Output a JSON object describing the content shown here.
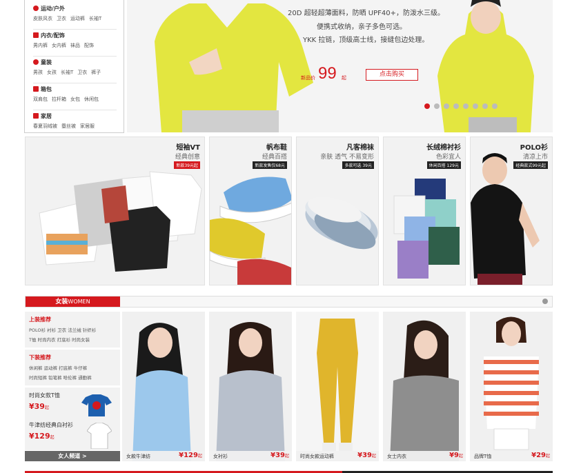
{
  "categories": [
    {
      "title": "运动/户外",
      "links": [
        "皮肤风衣",
        "卫衣",
        "运动裤",
        "长袖T"
      ]
    },
    {
      "title": "内衣/配饰",
      "links": [
        "男内裤",
        "女内裤",
        "袜品",
        "配饰"
      ]
    },
    {
      "title": "童装",
      "links": [
        "男孩",
        "女孩",
        "长袖T",
        "卫衣",
        "裤子"
      ]
    },
    {
      "title": "箱包",
      "links": [
        "双肩包",
        "拉杆箱",
        "女包",
        "休闲包"
      ]
    },
    {
      "title": "家居",
      "links": [
        "春夏羽绒被",
        "蚕丝被",
        "家居服"
      ]
    }
  ],
  "banner": {
    "line1": "20D 超轻超薄面料，防晒 UPF40+，防泼水三级。",
    "line2": "便携式收纳，亲子多色可选。",
    "line3": "YKK 拉链，顶级高士线，接缝包边处理。",
    "price_label": "新品价",
    "price": "99",
    "price_unit": "起",
    "buy_label": "点击购买",
    "slide_count": 8,
    "active_slide": 1
  },
  "products": [
    {
      "title": "短袖VT",
      "sub": "经典创意",
      "tag": "新款39元起"
    },
    {
      "title": "帆布鞋",
      "sub": "经典百搭",
      "tag": "新款发售仅68元"
    },
    {
      "title": "凡客棉袜",
      "sub": "亲肤 透气 不易变形",
      "tag": "多款可选  39元"
    },
    {
      "title": "长绒棉衬衫",
      "sub": "色彩宜人",
      "tag": "休闲百搭 129元"
    },
    {
      "title": "POLO衫",
      "sub": "清凉上市",
      "tag": "经典款式99元起"
    }
  ],
  "women": {
    "label": "女装",
    "label_en": "WOMEN",
    "top_title": "上装推荐",
    "top_links_1": "POLO衫  衬衫  卫衣  法兰绒  针织衫",
    "top_links_2": "T恤  时尚内衣  打底衫  时尚女装",
    "bottom_title": "下装推荐",
    "bottom_links_1": "休闲裤  运动裤  打底裤  牛仔裤",
    "bottom_links_2": "时尚短裤  铅笔裤  哈伦裤  通勤裤",
    "promo1_title": "时尚女款T恤",
    "promo1_price": "¥39",
    "promo1_unit": "起",
    "promo2_title": "牛津纺经典白衬衫",
    "promo2_price": "¥129",
    "promo2_unit": "起",
    "channel_label": "女人频道 >",
    "cards": [
      {
        "name": "女款牛津纺",
        "price": "¥129",
        "unit": "起"
      },
      {
        "name": "女衬衫",
        "price": "¥39",
        "unit": "起"
      },
      {
        "name": "时尚女款运动裤",
        "price": "¥39",
        "unit": "起"
      },
      {
        "name": "女士内衣",
        "price": "¥9",
        "unit": "起"
      },
      {
        "name": "品牌T恤",
        "price": "¥29",
        "unit": "起"
      }
    ]
  },
  "colors": {
    "accent": "#d5191e",
    "banner_yellow": "#e6e84a"
  }
}
